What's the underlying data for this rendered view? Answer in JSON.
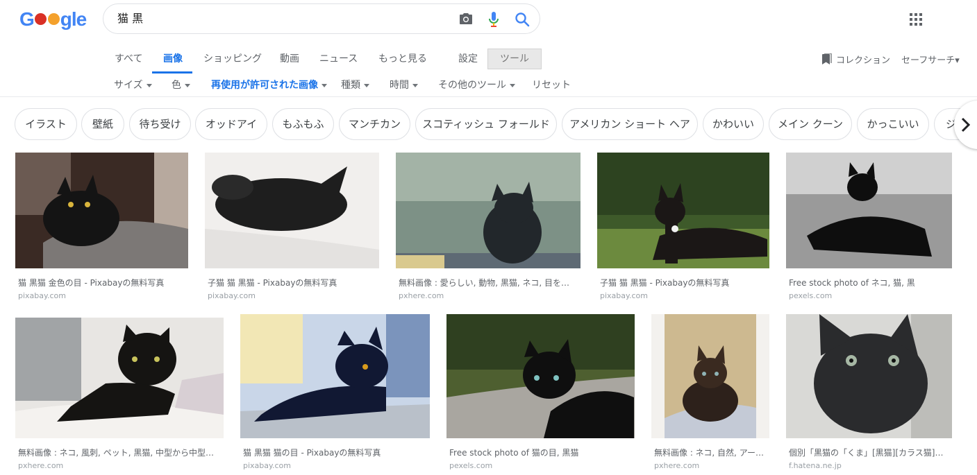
{
  "search": {
    "query": "猫 黒"
  },
  "logo": {
    "g": "G",
    "gle": "gle"
  },
  "tabs": [
    {
      "label": "すべて"
    },
    {
      "label": "画像"
    },
    {
      "label": "ショッピング"
    },
    {
      "label": "動画"
    },
    {
      "label": "ニュース"
    },
    {
      "label": "もっと見る"
    },
    {
      "label": "設定"
    },
    {
      "label": "ツール"
    }
  ],
  "right_links": {
    "collection": "コレクション",
    "safesearch": "セーフサーチ▾"
  },
  "filters": [
    {
      "label": "サイズ"
    },
    {
      "label": "色"
    },
    {
      "label": "再使用が許可された画像"
    },
    {
      "label": "種類"
    },
    {
      "label": "時間"
    },
    {
      "label": "その他のツール"
    },
    {
      "label": "リセット"
    }
  ],
  "chips": [
    {
      "label": "イラスト"
    },
    {
      "label": "壁紙"
    },
    {
      "label": "待ち受け"
    },
    {
      "label": "オッドアイ"
    },
    {
      "label": "もふもふ"
    },
    {
      "label": "マンチカン"
    },
    {
      "label": "スコティッシュ フォールド"
    },
    {
      "label": "アメリカン ショート ヘア"
    },
    {
      "label": "かわいい"
    },
    {
      "label": "メイン クーン"
    },
    {
      "label": "かっこいい"
    },
    {
      "label": "ジ"
    }
  ],
  "results": [
    {
      "caption": "猫 黒猫 金色の目 - Pixabayの無料写真",
      "source": "pixabay.com",
      "bg": "#3a2a24"
    },
    {
      "caption": "子猫 猫 黒猫 - Pixabayの無料写真",
      "source": "pixabay.com",
      "bg": "#e9e6e3"
    },
    {
      "caption": "無料画像 : 愛らしい, 動物, 黒猫, ネコ, 目を…",
      "source": "pxhere.com",
      "bg": "#6e8378"
    },
    {
      "caption": "子猫 猫 黒猫 - Pixabayの無料写真",
      "source": "pixabay.com",
      "bg": "#4e6a32"
    },
    {
      "caption": "Free stock photo of ネコ, 猫, 黒",
      "source": "pexels.com",
      "bg": "#8a8a8a"
    },
    {
      "caption": "無料画像 : ネコ, 風刺, ペット, 黒猫, 中型から中型…",
      "source": "pxhere.com",
      "bg": "#d8d4cf"
    },
    {
      "caption": "猫 黒猫 猫の目 - Pixabayの無料写真",
      "source": "pixabay.com",
      "bg": "#8ea3c2"
    },
    {
      "caption": "Free stock photo of 猫の目, 黒猫",
      "source": "pexels.com",
      "bg": "#5a6e3a"
    },
    {
      "caption": "無料画像 : ネコ, 自然, アー…",
      "source": "pxhere.com",
      "bg": "#bfb8ab"
    },
    {
      "caption": "個別「黒猫の「くま」[黒猫][カラス猫]…",
      "source": "f.hatena.ne.jp",
      "bg": "#9c9c98"
    }
  ]
}
